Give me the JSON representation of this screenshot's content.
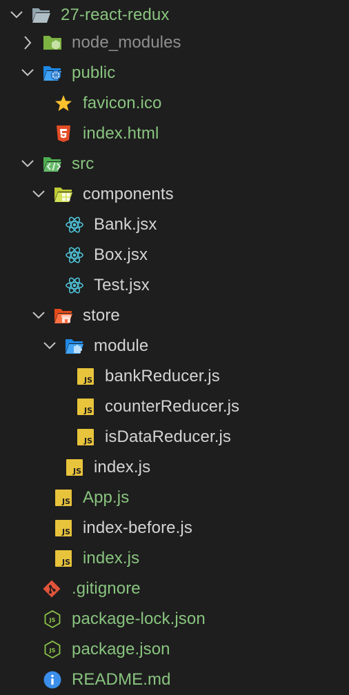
{
  "explorer": {
    "items": [
      {
        "label": "27-react-redux"
      },
      {
        "label": "node_modules"
      },
      {
        "label": "public"
      },
      {
        "label": "favicon.ico"
      },
      {
        "label": "index.html"
      },
      {
        "label": "src"
      },
      {
        "label": "components"
      },
      {
        "label": "Bank.jsx"
      },
      {
        "label": "Box.jsx"
      },
      {
        "label": "Test.jsx"
      },
      {
        "label": "store"
      },
      {
        "label": "module"
      },
      {
        "label": "bankReducer.js"
      },
      {
        "label": "counterReducer.js"
      },
      {
        "label": "isDataReducer.js"
      },
      {
        "label": "index.js"
      },
      {
        "label": "App.js"
      },
      {
        "label": "index-before.js"
      },
      {
        "label": "index.js"
      },
      {
        "label": ".gitignore"
      },
      {
        "label": "package-lock.json"
      },
      {
        "label": "package.json"
      },
      {
        "label": "README.md"
      }
    ],
    "js_badge": "JS"
  },
  "colors": {
    "background": "#1e1e1e",
    "git_added_text": "#89c47f",
    "ignored_text": "#8f8f8f",
    "js_badge": "#e8c33c",
    "react_icon": "#4fc3d9",
    "html_icon": "#e44d26",
    "git_icon": "#e2533b",
    "info_icon": "#3b8eea",
    "node_icon": "#8bc34a"
  }
}
